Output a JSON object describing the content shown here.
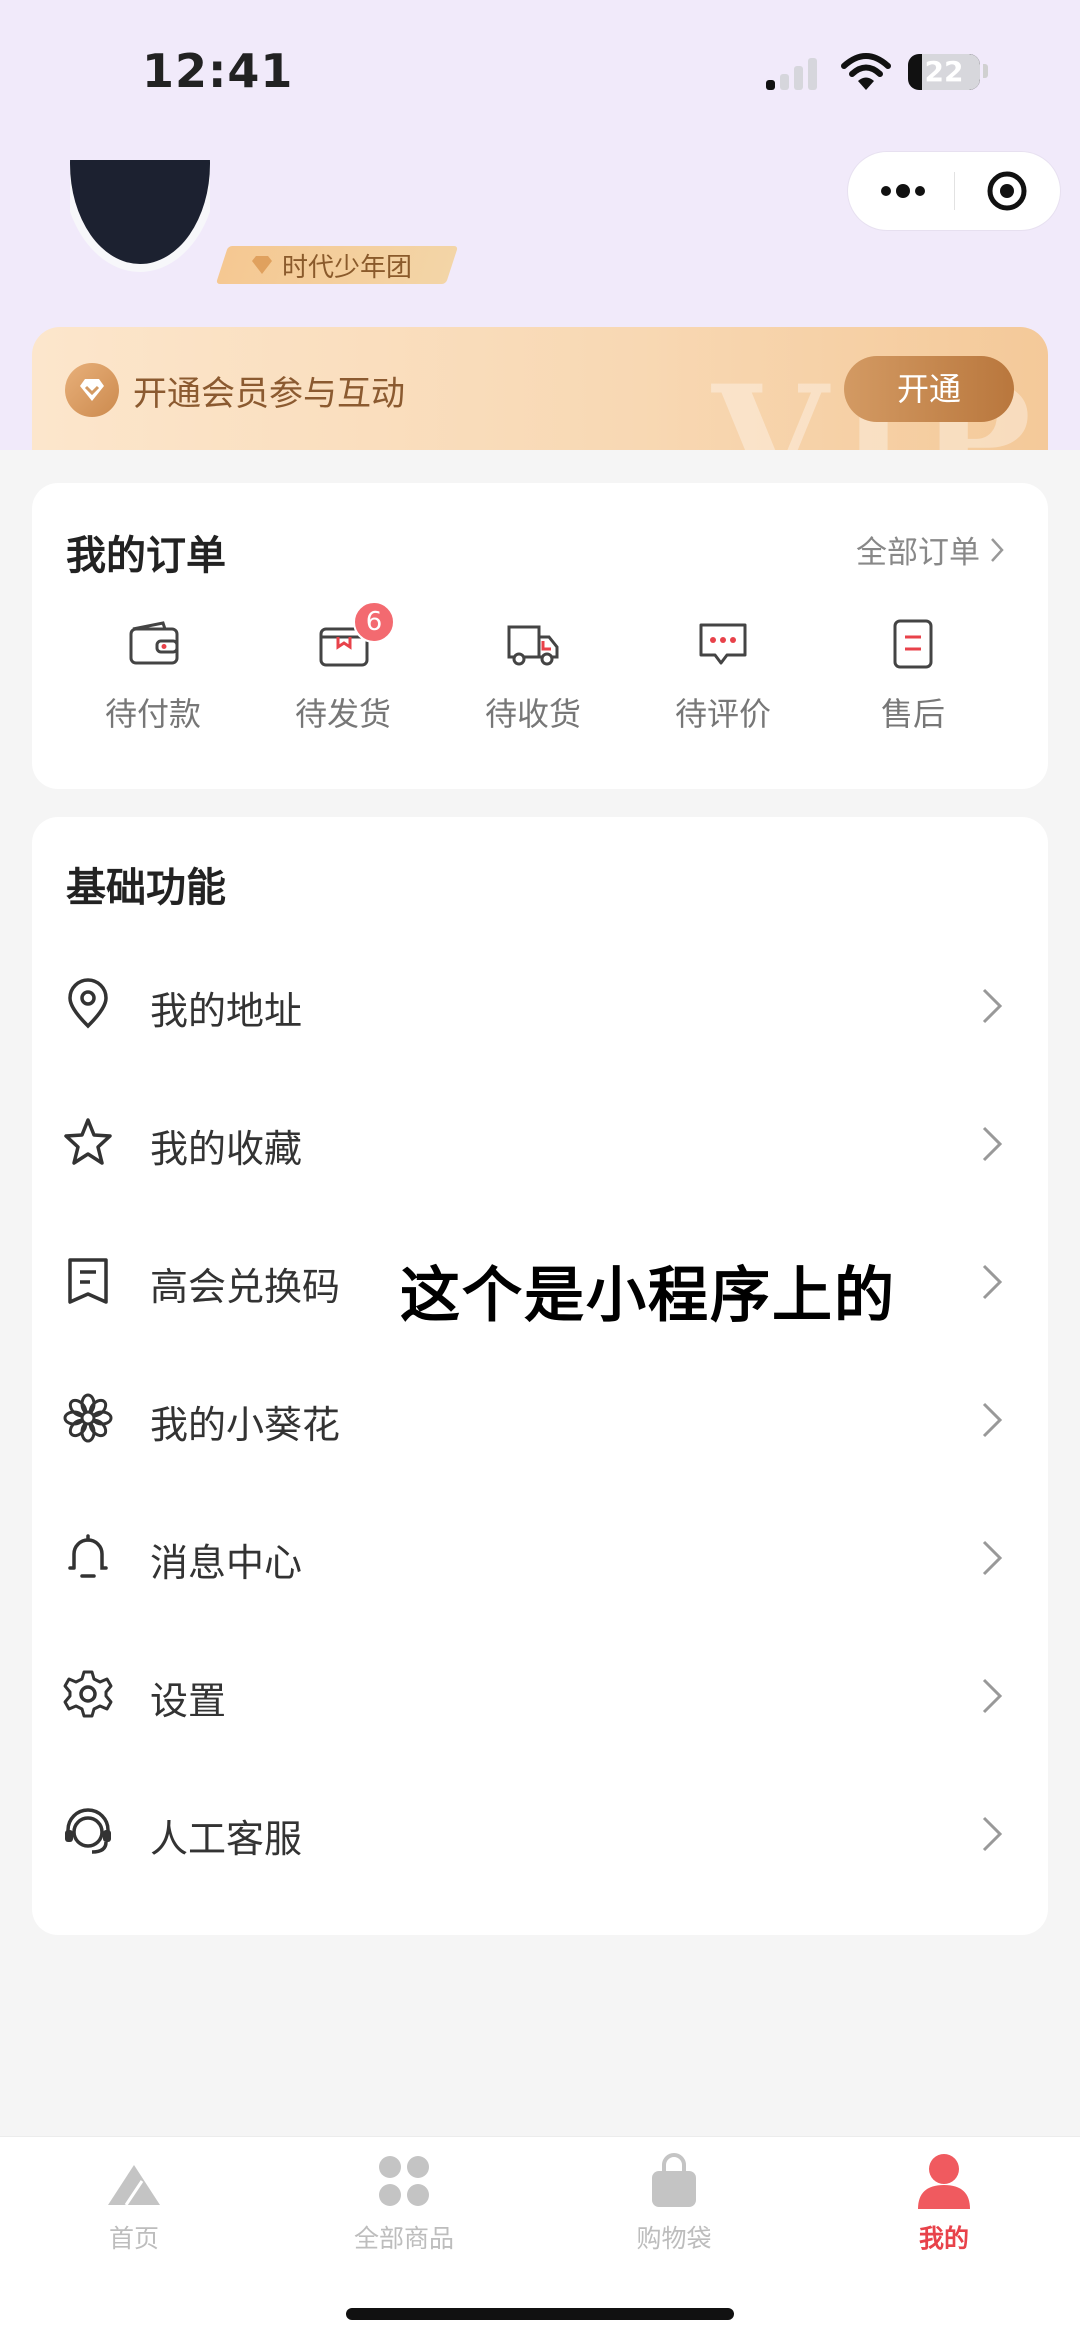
{
  "status_bar": {
    "time": "12:41",
    "battery": "22"
  },
  "profile": {
    "member_level": "时代少年团"
  },
  "vip_banner": {
    "text": "开通会员参与互动",
    "button": "开通",
    "watermark": "VIP"
  },
  "orders": {
    "title": "我的订单",
    "all_link": "全部订单",
    "items": [
      {
        "label": "待付款",
        "icon": "wallet-icon"
      },
      {
        "label": "待发货",
        "icon": "package-icon",
        "badge": "6"
      },
      {
        "label": "待收货",
        "icon": "truck-icon"
      },
      {
        "label": "待评价",
        "icon": "comment-icon"
      },
      {
        "label": "售后",
        "icon": "after-sale-icon"
      }
    ]
  },
  "functions": {
    "title": "基础功能",
    "items": [
      {
        "label": "我的地址",
        "icon": "location-pin-icon"
      },
      {
        "label": "我的收藏",
        "icon": "star-icon"
      },
      {
        "label": "高会兑换码",
        "icon": "coupon-code-icon"
      },
      {
        "label": "我的小葵花",
        "icon": "sunflower-icon"
      },
      {
        "label": "消息中心",
        "icon": "bell-icon"
      },
      {
        "label": "设置",
        "icon": "gear-icon"
      },
      {
        "label": "人工客服",
        "icon": "headset-icon"
      }
    ]
  },
  "overlay_caption": "这个是小程序上的",
  "tabbar": {
    "items": [
      {
        "label": "首页",
        "icon": "home-mountain-icon",
        "active": false
      },
      {
        "label": "全部商品",
        "icon": "grid-icon",
        "active": false
      },
      {
        "label": "购物袋",
        "icon": "shopping-bag-icon",
        "active": false
      },
      {
        "label": "我的",
        "icon": "user-icon",
        "active": true
      }
    ]
  },
  "colors": {
    "accent": "#e8424a",
    "vip_gold": "#b9773d",
    "header_bg": "#f1eafa",
    "badge": "#f36a70"
  }
}
